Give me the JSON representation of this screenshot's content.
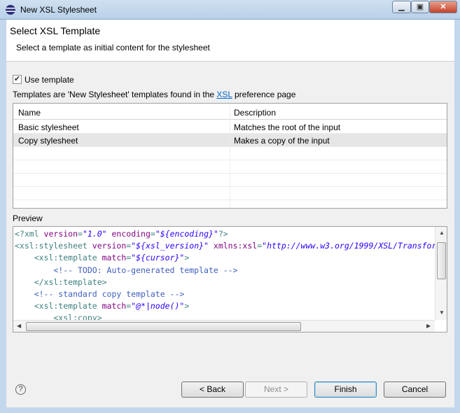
{
  "window": {
    "title": "New XSL Stylesheet",
    "controls": [
      "minimize",
      "maximize",
      "close"
    ]
  },
  "header": {
    "title": "Select XSL Template",
    "subtitle": "Select a template as initial content for the stylesheet"
  },
  "use_template": {
    "label": "Use template",
    "checked": true
  },
  "info": {
    "prefix": "Templates are 'New Stylesheet' templates found in the ",
    "link": "XSL",
    "suffix": " preference page"
  },
  "table": {
    "columns": [
      "Name",
      "Description"
    ],
    "rows": [
      {
        "name": "Basic stylesheet",
        "description": "Matches the root of the input"
      },
      {
        "name": "Copy stylesheet",
        "description": "Makes a copy of the input",
        "selected": true
      }
    ]
  },
  "preview": {
    "label": "Preview"
  },
  "buttons": {
    "back": "< Back",
    "next": "Next >",
    "finish": "Finish",
    "cancel": "Cancel"
  },
  "colors": {
    "tag": "#3f7f7f",
    "attribute": "#7f007f",
    "value": "#2a00ff",
    "comment": "#3f5fbf"
  }
}
